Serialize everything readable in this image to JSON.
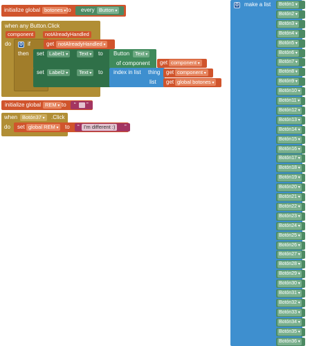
{
  "colors": {
    "orange": "#d0542c",
    "mustard": "#b18e35",
    "green": "#2f7048",
    "green_light": "#5ba55b",
    "blue": "#3e8fcf",
    "magenta": "#a33561",
    "blue_chip": "#4c8a63"
  },
  "init_botones": {
    "label": "initialize global",
    "name": "botones",
    "to": "to",
    "every": "every",
    "component_type": "Button"
  },
  "event_any": {
    "title": "when any Button.Click",
    "param1": "component",
    "param2": "notAlreadyHandled",
    "do": "do",
    "if": "if",
    "then": "then",
    "get": "get",
    "get_var": "notAlreadyHandled"
  },
  "set1": {
    "set": "set",
    "component": "Label1",
    "property": "Text",
    "to": "to",
    "getter_type": "Button",
    "getter_prop": "Text",
    "of_component": "of component",
    "get": "get",
    "get_var": "component"
  },
  "set2": {
    "set": "set",
    "component": "Label2",
    "property": "Text",
    "to": "to",
    "index_label": "index in list",
    "thing": "thing",
    "list": "list",
    "get": "get",
    "thing_var": "component",
    "list_var": "global botones"
  },
  "init_rem": {
    "label": "initialize global",
    "name": "REM",
    "to": "to",
    "quote_open": "“",
    "quote_close": "”"
  },
  "event_boton37": {
    "when": "when",
    "component": "Botón37",
    "event": ".Click",
    "do": "do",
    "set": "set",
    "var": "global REM",
    "to": "to",
    "text": "I'm different :)"
  },
  "make_list": {
    "label": "make a list",
    "items": [
      "Botón1",
      "Botón2",
      "Botón3",
      "Botón4",
      "Botón5",
      "Botón6",
      "Botón7",
      "Botón8",
      "Botón9",
      "Botón10",
      "Botón11",
      "Botón12",
      "Botón13",
      "Botón14",
      "Botón15",
      "Botón16",
      "Botón17",
      "Botón18",
      "Botón19",
      "Botón20",
      "Botón21",
      "Botón22",
      "Botón23",
      "Botón24",
      "Botón25",
      "Botón26",
      "Botón27",
      "Botón28",
      "Botón29",
      "Botón30",
      "Botón31",
      "Botón32",
      "Botón33",
      "Botón34",
      "Botón35",
      "Botón36"
    ]
  }
}
